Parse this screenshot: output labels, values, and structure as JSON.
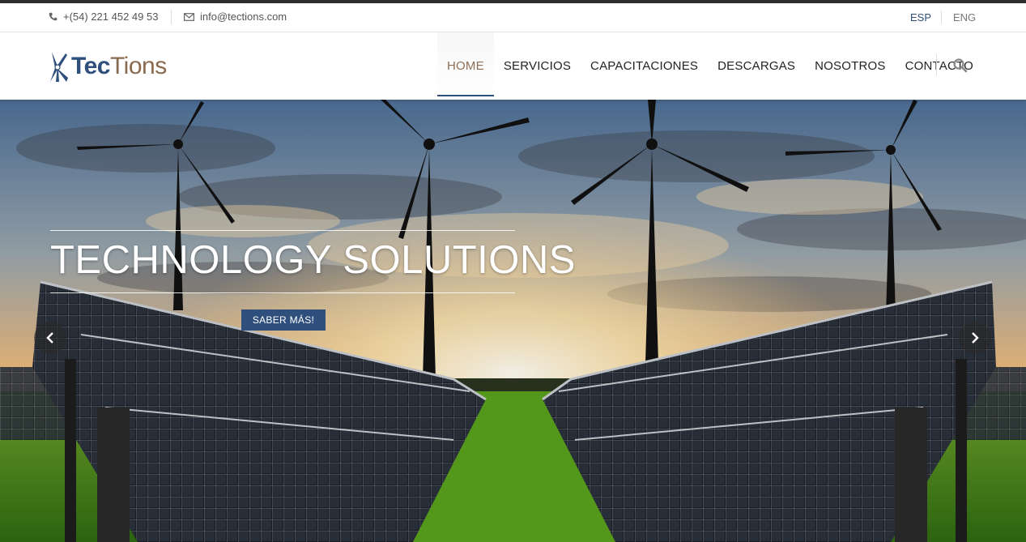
{
  "topbar": {
    "phone": "+(54) 221 452 49 53",
    "email": "info@tections.com",
    "languages": [
      {
        "label": "ESP",
        "active": true
      },
      {
        "label": "ENG",
        "active": false
      }
    ]
  },
  "brand": {
    "logo_part1": "Tec",
    "logo_part2": "Tions",
    "colors": {
      "primary": "#2f4f7d",
      "secondary": "#8a6a4f"
    }
  },
  "nav": {
    "items": [
      {
        "label": "HOME",
        "active": true
      },
      {
        "label": "SERVICIOS"
      },
      {
        "label": "CAPACITACIONES"
      },
      {
        "label": "DESCARGAS"
      },
      {
        "label": "NOSOTROS"
      },
      {
        "label": "CONTACTO"
      }
    ],
    "search_icon": "search-icon"
  },
  "hero": {
    "title": "TECHNOLOGY SOLUTIONS",
    "button_label": "SABER MÁS!",
    "icons": {
      "prev": "chevron-left-icon",
      "next": "chevron-right-icon"
    }
  }
}
